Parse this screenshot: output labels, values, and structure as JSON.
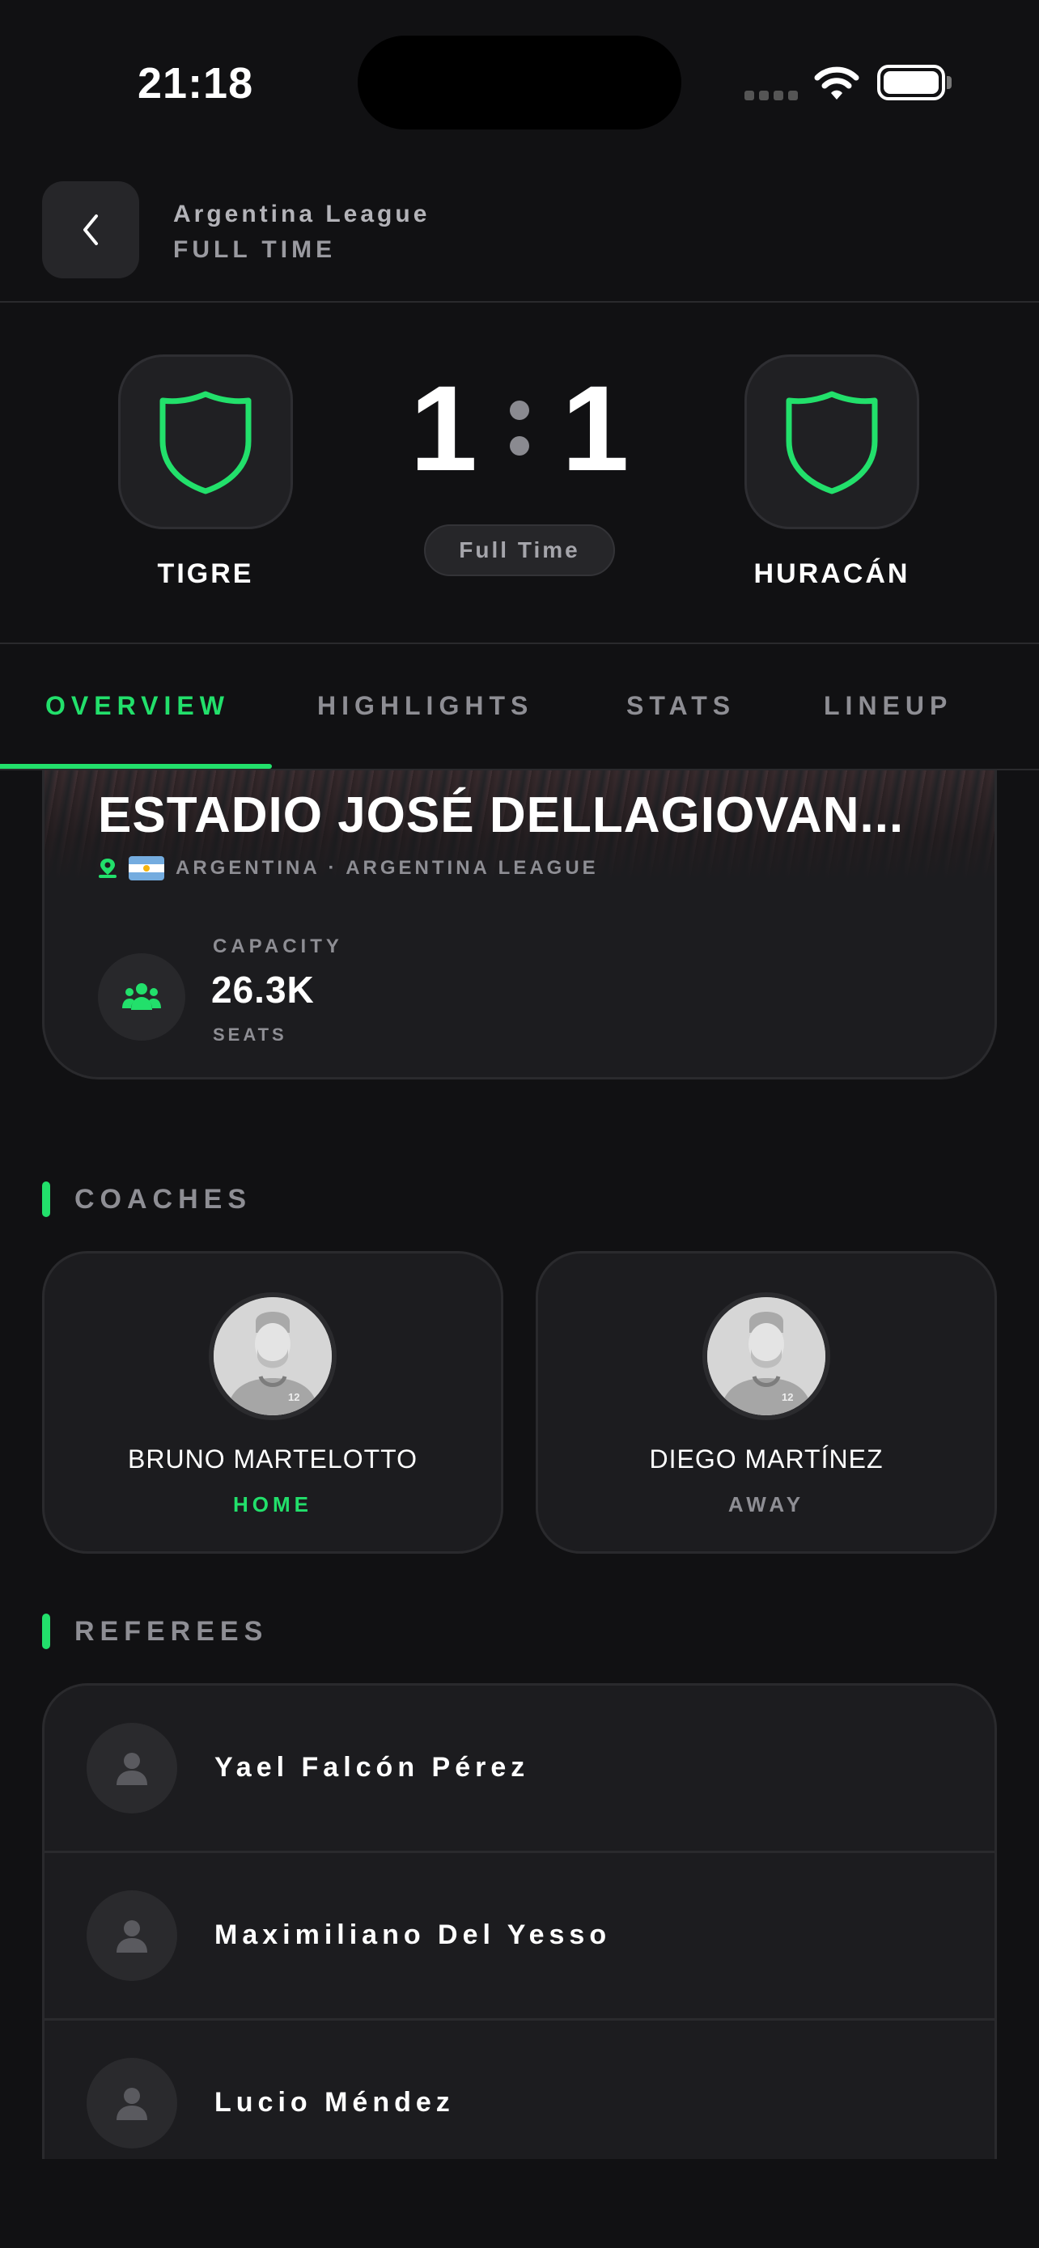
{
  "status_bar": {
    "time": "21:18"
  },
  "header": {
    "league": "Argentina League",
    "status": "FULL TIME"
  },
  "match": {
    "home_team": "TIGRE",
    "away_team": "HURACÁN",
    "home_score": "1",
    "away_score": "1",
    "status_pill": "Full Time"
  },
  "tabs": [
    {
      "label": "OVERVIEW",
      "active": true
    },
    {
      "label": "HIGHLIGHTS",
      "active": false
    },
    {
      "label": "STATS",
      "active": false
    },
    {
      "label": "LINEUP",
      "active": false
    }
  ],
  "venue": {
    "name": "ESTADIO JOSÉ DELLAGIOVAN...",
    "subtitle": "ARGENTINA · ARGENTINA LEAGUE",
    "capacity_label": "CAPACITY",
    "capacity_value": "26.3K",
    "capacity_unit": "SEATS"
  },
  "coaches": {
    "title": "COACHES",
    "home": {
      "name": "BRUNO MARTELOTTO",
      "role": "HOME",
      "jersey_number": "12"
    },
    "away": {
      "name": "DIEGO MARTÍNEZ",
      "role": "AWAY",
      "jersey_number": "12"
    }
  },
  "referees": {
    "title": "REFEREES",
    "items": [
      {
        "name": "Yael Falcón Pérez"
      },
      {
        "name": "Maximiliano Del Yesso"
      },
      {
        "name": "Lucio Méndez"
      }
    ]
  },
  "colors": {
    "accent": "#22e06b",
    "background": "#111113",
    "card": "#1c1c1f"
  }
}
